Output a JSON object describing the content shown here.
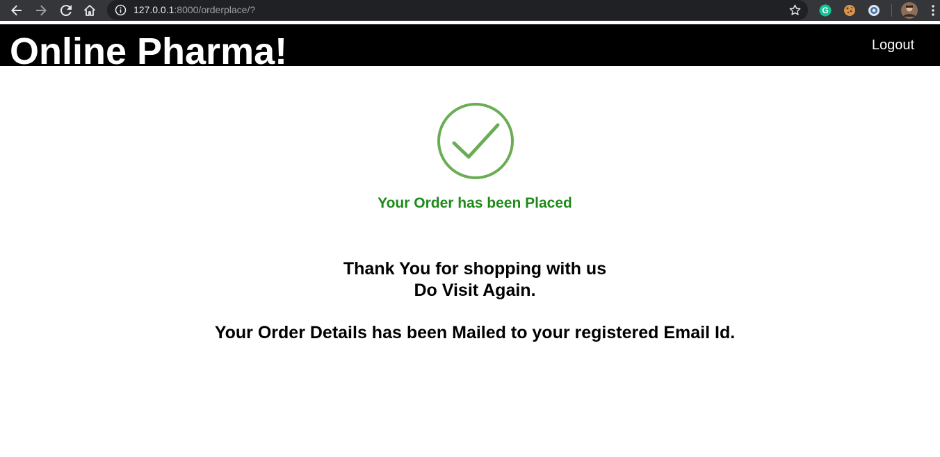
{
  "browser": {
    "url_host": "127.0.0.1",
    "url_rest": ":8000/orderplace/?",
    "icons": [
      "back-arrow-icon",
      "forward-arrow-icon",
      "reload-icon",
      "home-icon",
      "info-icon",
      "bookmark-star-icon",
      "grammarly-extension-icon",
      "cookie-extension-icon",
      "extension-icon",
      "profile-avatar-icon",
      "menu-dots-icon"
    ]
  },
  "header": {
    "title": "Online Pharma!",
    "logout_label": "Logout",
    "background": "#000000"
  },
  "main": {
    "success_icon": "checkmark-circle-icon",
    "success_color": "#6aad55",
    "placed_message": "Your Order has been Placed",
    "placed_color": "#1d8a1a",
    "thanks_line1": "Thank You for shopping with us",
    "thanks_line2": "Do Visit Again.",
    "mailed_message": "Your Order Details has been Mailed to your registered Email Id."
  }
}
